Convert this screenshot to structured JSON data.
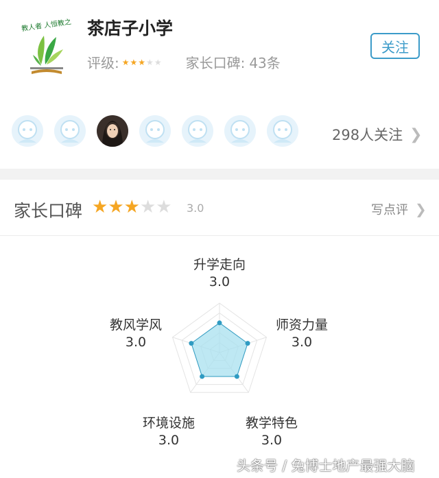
{
  "school": {
    "name": "茶店子小学",
    "logo_icon": "school-logo-icon",
    "rating_label": "评级:",
    "rating_stars": 3,
    "rating_max": 5,
    "reviews_label": "家长口碑:",
    "reviews_count": "43条",
    "follow_label": "关注"
  },
  "followers": {
    "avatars": [
      "default-avatar-icon",
      "default-avatar-icon",
      "user-photo-avatar",
      "default-avatar-icon",
      "default-avatar-icon",
      "default-avatar-icon",
      "default-avatar-icon"
    ],
    "count_text": "298人关注"
  },
  "reviews": {
    "title": "家长口碑",
    "stars": 3,
    "max": 5,
    "score": "3.0",
    "write_label": "写点评"
  },
  "radar": {
    "dimensions": [
      {
        "label": "升学走向",
        "value": "3.0"
      },
      {
        "label": "师资力量",
        "value": "3.0"
      },
      {
        "label": "教学特色",
        "value": "3.0"
      },
      {
        "label": "环境设施",
        "value": "3.0"
      },
      {
        "label": "教风学风",
        "value": "3.0"
      }
    ],
    "max": 5
  },
  "watermark": "头条号 / 兔博士地产最强大脑",
  "colors": {
    "accent": "#3b9bc9",
    "star_on": "#f5a623",
    "star_off": "#dddddd",
    "radar_fill": "#a8e0ef",
    "radar_stroke": "#2f9bc2"
  }
}
